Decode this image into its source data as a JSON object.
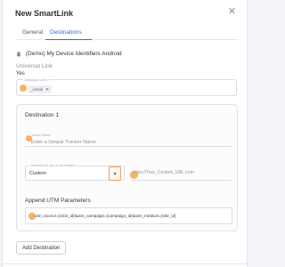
{
  "dialog": {
    "title": "New SmartLink",
    "close_glyph": "✕"
  },
  "tabs": [
    {
      "label": "General",
      "active": false
    },
    {
      "label": "Destinations",
      "active": true
    }
  ],
  "app": {
    "icon": "android-icon",
    "name": "(Demo) My Device Identifiers Android"
  },
  "universal_link": {
    "label": "Universal Link",
    "value": "Yes"
  },
  "campaign": {
    "label": "Campaign name",
    "chip_text": "_install",
    "chip_remove": "✕"
  },
  "destination": {
    "title": "Destination 1",
    "tracker_label": "Tracker Name",
    "tracker_placeholder": "Enter a Unique Tracker Name",
    "if_not_installed_label": "Destination if app is not installed",
    "if_not_installed_value": "Custom",
    "arrow_glyph": "▾",
    "custom_url_placeholder": "https://Your_Custom_URL.com",
    "utm_label": "Append UTM Parameters",
    "utm_value": "utm_source={click_id}&utm_campaign={campaign_id}&utm_medium={site_id}"
  },
  "add_destination_label": "Add Destination",
  "colors": {
    "accent": "#2d6fd6",
    "highlight": "#f6a34a"
  }
}
